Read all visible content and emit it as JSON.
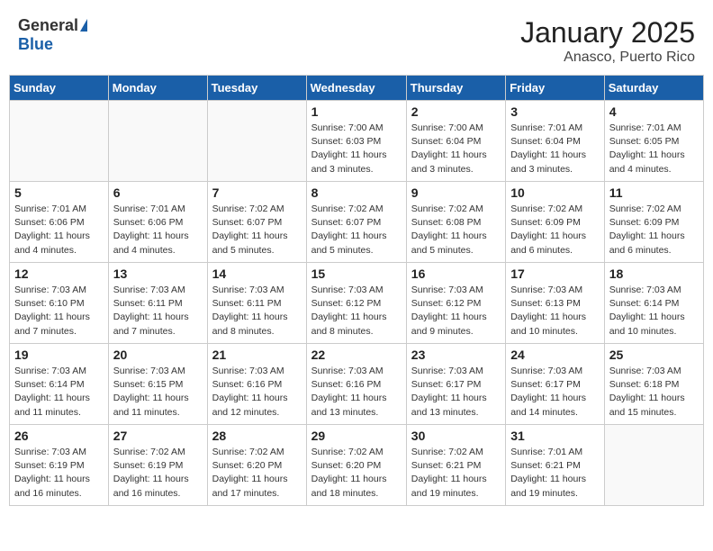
{
  "logo": {
    "general": "General",
    "blue": "Blue"
  },
  "header": {
    "month": "January 2025",
    "location": "Anasco, Puerto Rico"
  },
  "days_of_week": [
    "Sunday",
    "Monday",
    "Tuesday",
    "Wednesday",
    "Thursday",
    "Friday",
    "Saturday"
  ],
  "weeks": [
    [
      {
        "day": "",
        "info": ""
      },
      {
        "day": "",
        "info": ""
      },
      {
        "day": "",
        "info": ""
      },
      {
        "day": "1",
        "info": "Sunrise: 7:00 AM\nSunset: 6:03 PM\nDaylight: 11 hours\nand 3 minutes."
      },
      {
        "day": "2",
        "info": "Sunrise: 7:00 AM\nSunset: 6:04 PM\nDaylight: 11 hours\nand 3 minutes."
      },
      {
        "day": "3",
        "info": "Sunrise: 7:01 AM\nSunset: 6:04 PM\nDaylight: 11 hours\nand 3 minutes."
      },
      {
        "day": "4",
        "info": "Sunrise: 7:01 AM\nSunset: 6:05 PM\nDaylight: 11 hours\nand 4 minutes."
      }
    ],
    [
      {
        "day": "5",
        "info": "Sunrise: 7:01 AM\nSunset: 6:06 PM\nDaylight: 11 hours\nand 4 minutes."
      },
      {
        "day": "6",
        "info": "Sunrise: 7:01 AM\nSunset: 6:06 PM\nDaylight: 11 hours\nand 4 minutes."
      },
      {
        "day": "7",
        "info": "Sunrise: 7:02 AM\nSunset: 6:07 PM\nDaylight: 11 hours\nand 5 minutes."
      },
      {
        "day": "8",
        "info": "Sunrise: 7:02 AM\nSunset: 6:07 PM\nDaylight: 11 hours\nand 5 minutes."
      },
      {
        "day": "9",
        "info": "Sunrise: 7:02 AM\nSunset: 6:08 PM\nDaylight: 11 hours\nand 5 minutes."
      },
      {
        "day": "10",
        "info": "Sunrise: 7:02 AM\nSunset: 6:09 PM\nDaylight: 11 hours\nand 6 minutes."
      },
      {
        "day": "11",
        "info": "Sunrise: 7:02 AM\nSunset: 6:09 PM\nDaylight: 11 hours\nand 6 minutes."
      }
    ],
    [
      {
        "day": "12",
        "info": "Sunrise: 7:03 AM\nSunset: 6:10 PM\nDaylight: 11 hours\nand 7 minutes."
      },
      {
        "day": "13",
        "info": "Sunrise: 7:03 AM\nSunset: 6:11 PM\nDaylight: 11 hours\nand 7 minutes."
      },
      {
        "day": "14",
        "info": "Sunrise: 7:03 AM\nSunset: 6:11 PM\nDaylight: 11 hours\nand 8 minutes."
      },
      {
        "day": "15",
        "info": "Sunrise: 7:03 AM\nSunset: 6:12 PM\nDaylight: 11 hours\nand 8 minutes."
      },
      {
        "day": "16",
        "info": "Sunrise: 7:03 AM\nSunset: 6:12 PM\nDaylight: 11 hours\nand 9 minutes."
      },
      {
        "day": "17",
        "info": "Sunrise: 7:03 AM\nSunset: 6:13 PM\nDaylight: 11 hours\nand 10 minutes."
      },
      {
        "day": "18",
        "info": "Sunrise: 7:03 AM\nSunset: 6:14 PM\nDaylight: 11 hours\nand 10 minutes."
      }
    ],
    [
      {
        "day": "19",
        "info": "Sunrise: 7:03 AM\nSunset: 6:14 PM\nDaylight: 11 hours\nand 11 minutes."
      },
      {
        "day": "20",
        "info": "Sunrise: 7:03 AM\nSunset: 6:15 PM\nDaylight: 11 hours\nand 11 minutes."
      },
      {
        "day": "21",
        "info": "Sunrise: 7:03 AM\nSunset: 6:16 PM\nDaylight: 11 hours\nand 12 minutes."
      },
      {
        "day": "22",
        "info": "Sunrise: 7:03 AM\nSunset: 6:16 PM\nDaylight: 11 hours\nand 13 minutes."
      },
      {
        "day": "23",
        "info": "Sunrise: 7:03 AM\nSunset: 6:17 PM\nDaylight: 11 hours\nand 13 minutes."
      },
      {
        "day": "24",
        "info": "Sunrise: 7:03 AM\nSunset: 6:17 PM\nDaylight: 11 hours\nand 14 minutes."
      },
      {
        "day": "25",
        "info": "Sunrise: 7:03 AM\nSunset: 6:18 PM\nDaylight: 11 hours\nand 15 minutes."
      }
    ],
    [
      {
        "day": "26",
        "info": "Sunrise: 7:03 AM\nSunset: 6:19 PM\nDaylight: 11 hours\nand 16 minutes."
      },
      {
        "day": "27",
        "info": "Sunrise: 7:02 AM\nSunset: 6:19 PM\nDaylight: 11 hours\nand 16 minutes."
      },
      {
        "day": "28",
        "info": "Sunrise: 7:02 AM\nSunset: 6:20 PM\nDaylight: 11 hours\nand 17 minutes."
      },
      {
        "day": "29",
        "info": "Sunrise: 7:02 AM\nSunset: 6:20 PM\nDaylight: 11 hours\nand 18 minutes."
      },
      {
        "day": "30",
        "info": "Sunrise: 7:02 AM\nSunset: 6:21 PM\nDaylight: 11 hours\nand 19 minutes."
      },
      {
        "day": "31",
        "info": "Sunrise: 7:01 AM\nSunset: 6:21 PM\nDaylight: 11 hours\nand 19 minutes."
      },
      {
        "day": "",
        "info": ""
      }
    ]
  ]
}
